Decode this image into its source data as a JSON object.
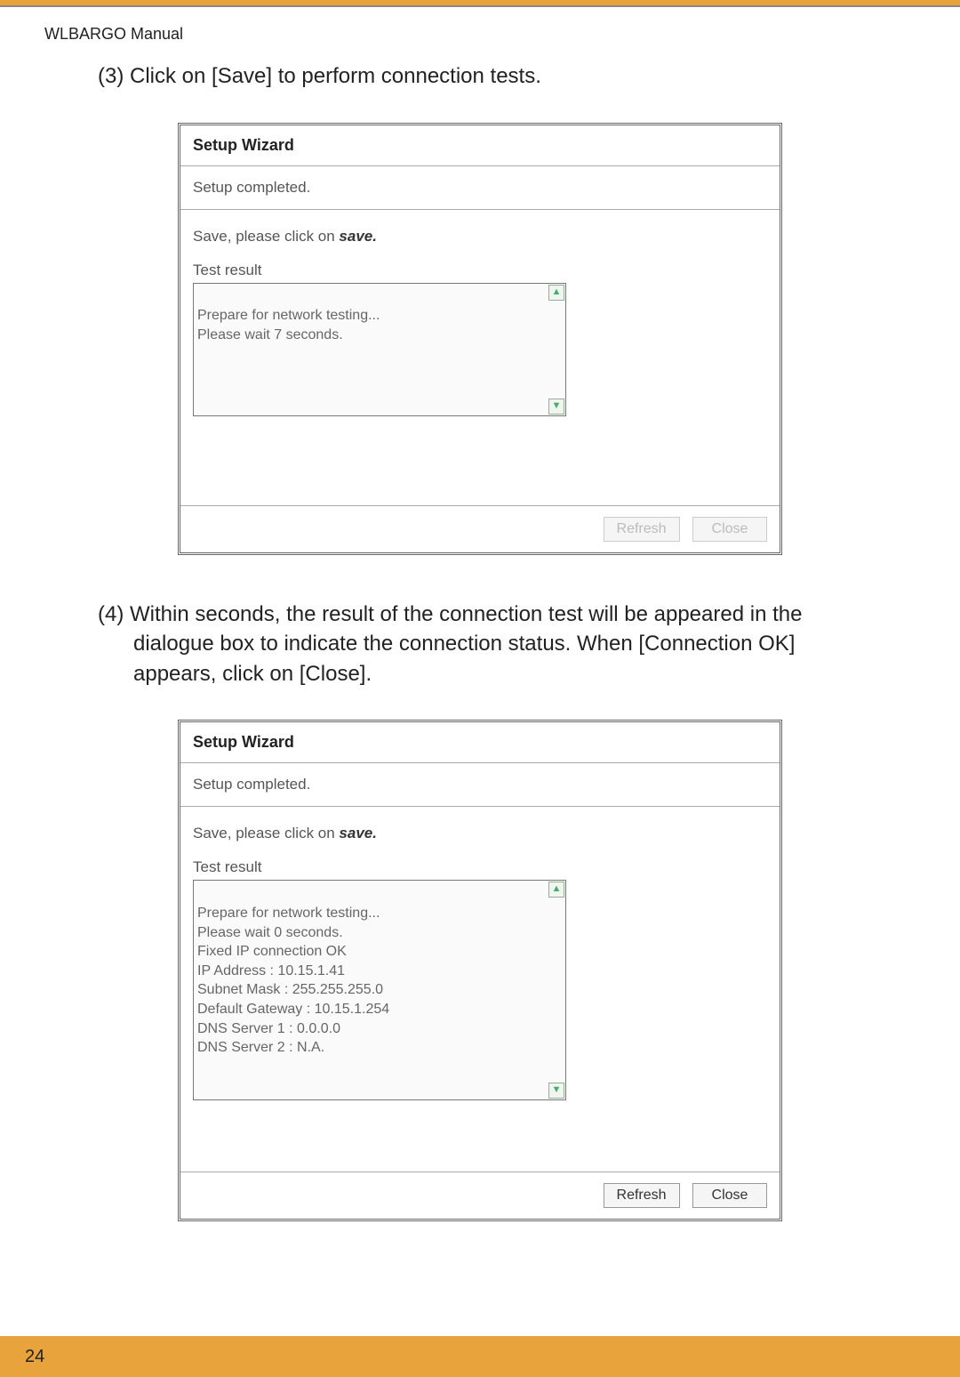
{
  "header": {
    "manual_title": "WLBARGO Manual"
  },
  "step3": {
    "text": "(3) Click on [Save] to perform connection tests."
  },
  "wizard1": {
    "title": "Setup Wizard",
    "status": "Setup completed.",
    "save_prefix": "Save, please click on ",
    "save_bold": "save.",
    "test_label": "Test result",
    "result_lines": "Prepare for network testing...\nPlease wait  7  seconds.",
    "refresh": "Refresh",
    "close": "Close"
  },
  "step4": {
    "text": "(4) Within seconds, the result of the connection test will be appeared in the dialogue box to indicate the connection status. When [Connection OK] appears, click on [Close]."
  },
  "wizard2": {
    "title": "Setup Wizard",
    "status": "Setup completed.",
    "save_prefix": "Save, please click on ",
    "save_bold": "save.",
    "test_label": "Test result",
    "result_lines": "Prepare for network testing...\nPlease wait  0  seconds.\nFixed IP connection OK\nIP Address : 10.15.1.41\nSubnet Mask : 255.255.255.0\nDefault Gateway : 10.15.1.254\nDNS Server 1 : 0.0.0.0\nDNS Server 2 : N.A.",
    "refresh": "Refresh",
    "close": "Close"
  },
  "footer": {
    "page_number": "24"
  }
}
